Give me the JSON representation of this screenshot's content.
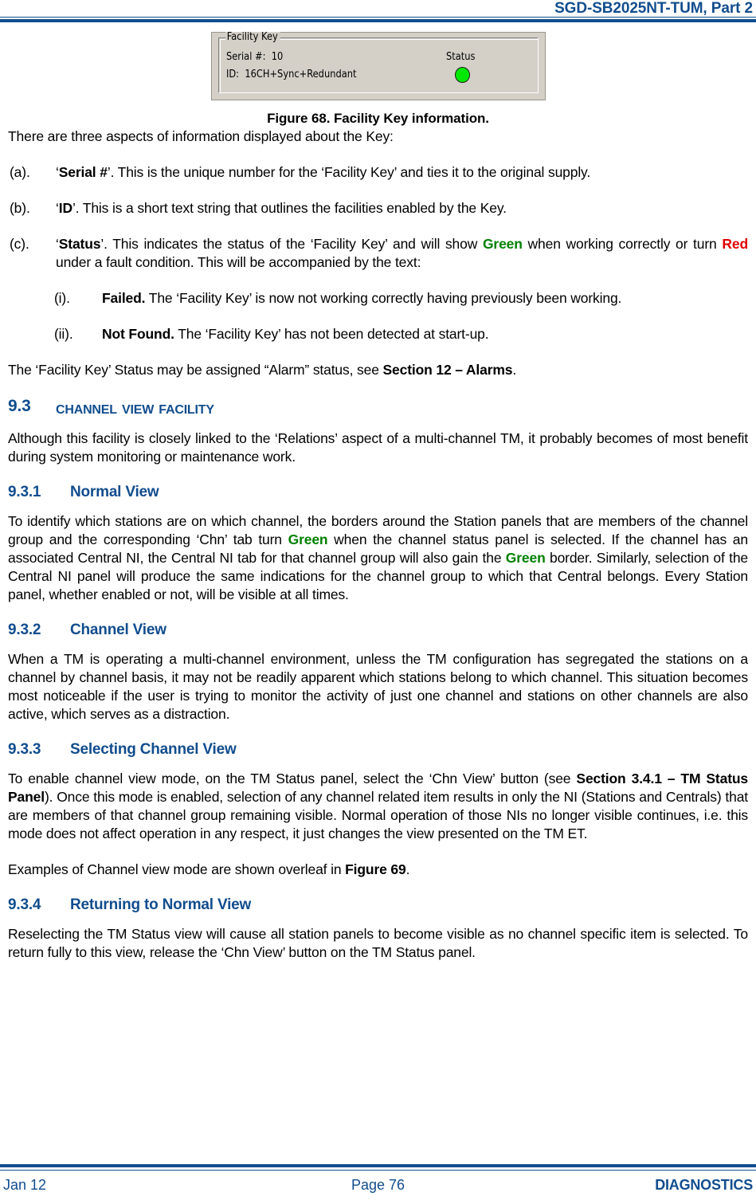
{
  "header": {
    "title": "SGD-SB2025NT-TUM, Part 2"
  },
  "figure": {
    "caption": "Figure 68.  Facility Key information.",
    "screenshot": {
      "groupbox_legend": "Facility Key",
      "serial_label": "Serial #:",
      "serial_value": "10",
      "id_label": "ID:",
      "id_value": "16CH+Sync+Redundant",
      "status_label": "Status",
      "status_led": "green-status-led",
      "status_color": "#00E800"
    }
  },
  "intro": {
    "lead": "There are three aspects of information displayed about the Key:"
  },
  "list_a": [
    {
      "marker": "(a).",
      "term_open": "‘",
      "term": "Serial #",
      "term_close": "’.",
      "text": "  This is the unique number for the ‘Facility Key’ and ties it to the original supply."
    },
    {
      "marker": "(b).",
      "term_open": "‘",
      "term": "ID",
      "term_close": "’.",
      "text": "  This is a short text string that outlines the facilities enabled by the Key."
    }
  ],
  "item_c": {
    "marker": "(c).",
    "term_open": "‘",
    "term": "Status",
    "term_close": "’.",
    "text_1": "  This indicates the status of the ‘Facility Key’ and will show ",
    "green_word": "Green",
    "text_2": " when working correctly or turn ",
    "red_word": "Red",
    "text_3": " under a fault condition.  This will be accompanied by the text:"
  },
  "list_i": [
    {
      "marker": "(i).",
      "term": "Failed.",
      "text": "  The ‘Facility Key’ is now not working correctly having previously been working."
    },
    {
      "marker": "(ii).",
      "term": "Not Found.",
      "text": "  The ‘Facility Key’ has not been detected at start-up."
    }
  ],
  "alarm_note": {
    "text_1": "The ‘Facility Key’ Status may be assigned “Alarm” status, see ",
    "bold_ref": "Section 12 – Alarms",
    "text_2": "."
  },
  "section_9_3": {
    "number": "9.3",
    "title": "Channel View Facility",
    "intro": "Although this facility is closely linked to the ‘Relations’ aspect of a multi-channel TM, it probably becomes of most benefit during system monitoring or maintenance work."
  },
  "section_9_3_1": {
    "number": "9.3.1",
    "title": "Normal View",
    "text_1": "To identify which stations are on which channel, the borders around the Station panels that are members of the channel group and the corresponding ‘Chn’ tab turn ",
    "green_word_1": "Green",
    "text_2": " when the channel status panel is selected.  If the channel has an associated Central NI, the Central NI tab for that channel group will also gain the ",
    "green_word_2": "Green",
    "text_3": " border.  Similarly, selection of the Central NI panel will produce the same indications for the channel group to which that Central belongs.  Every Station panel, whether enabled or not, will be visible at all times."
  },
  "section_9_3_2": {
    "number": "9.3.2",
    "title": "Channel View",
    "text": "When a TM is operating a multi-channel environment, unless the TM configuration has segregated the stations on a channel by channel basis, it may not be readily apparent which stations belong to which channel.  This situation becomes most noticeable if the user is trying to monitor the activity of just one channel and stations on other channels are also active, which serves as a distraction."
  },
  "section_9_3_3": {
    "number": "9.3.3",
    "title": "Selecting Channel View",
    "text_1": "To enable channel view mode, on the TM Status panel, select the ‘Chn View’ button (see ",
    "bold_ref": "Section 3.4.1 – TM Status Panel",
    "text_2": ").  Once this mode is enabled, selection of any channel related item results in only the NI (Stations and Centrals) that are members of that channel group remaining visible.  Normal operation of those NIs no longer visible continues, i.e. this mode does not affect operation in any respect, it just changes the view presented on the TM ET.",
    "examples_1": "Examples of Channel view mode are shown overleaf in ",
    "examples_ref": "Figure 69",
    "examples_2": "."
  },
  "section_9_3_4": {
    "number": "9.3.4",
    "title": "Returning to Normal View",
    "text": "Reselecting the TM Status view will cause all station panels to become visible as no channel specific item is selected.  To return fully to this view, release the ‘Chn View’ button on the TM Status panel."
  },
  "footer": {
    "date": "Jan 12",
    "page": "Page 76",
    "section": "DIAGNOSTICS"
  }
}
